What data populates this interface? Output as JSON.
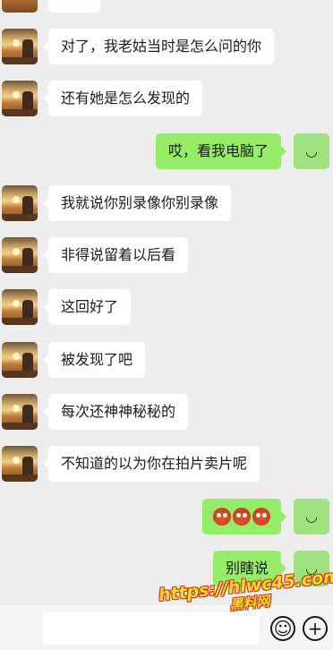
{
  "messages": [
    {
      "side": "left",
      "text": "对了，我老姑当时是怎么问的你"
    },
    {
      "side": "left",
      "text": "还有她是怎么发现的"
    },
    {
      "side": "right",
      "text": "哎，看我电脑了"
    },
    {
      "side": "left",
      "text": "我就说你别录像你别录像"
    },
    {
      "side": "left",
      "text": "非得说留着以后看"
    },
    {
      "side": "left",
      "text": "这回好了"
    },
    {
      "side": "left",
      "text": "被发现了吧"
    },
    {
      "side": "left",
      "text": "每次还神神秘秘的"
    },
    {
      "side": "left",
      "text": "不知道的以为你在拍片卖片呢"
    },
    {
      "side": "right",
      "text": "",
      "emoji_count": 3,
      "emoji_name": "angry-emoji"
    },
    {
      "side": "right",
      "text": "别瞎说"
    }
  ],
  "input_bar": {
    "emoji_icon": "smiley-icon",
    "plus_icon": "plus-icon",
    "emoji_glyph": "☺",
    "plus_glyph": "+"
  },
  "self_avatar": {
    "glyph": "◡"
  },
  "watermark": {
    "url": "https://hlwc45.com",
    "sub": "黑料网"
  },
  "colors": {
    "background": "#ededed",
    "left_bubble": "#ffffff",
    "right_bubble": "#95ec69",
    "self_avatar": "#9fe07f"
  }
}
